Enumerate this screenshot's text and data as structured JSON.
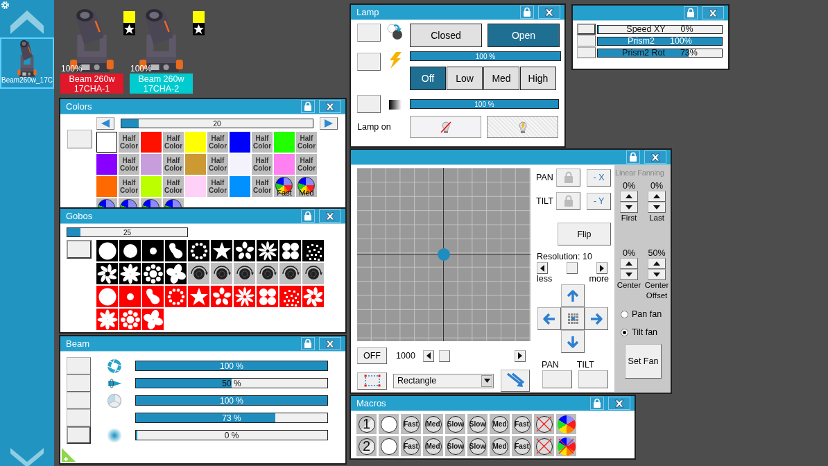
{
  "sidebar": {
    "fixtures": [
      {
        "label": "Beam260w_17C",
        "selected": true
      }
    ]
  },
  "fixtures": [
    {
      "intensity": "100%",
      "name": "Beam 260w",
      "channel": "17CHA-1",
      "color": "#e0182a"
    },
    {
      "intensity": "100%",
      "name": "Beam 260w",
      "channel": "17CHA-2",
      "color": "#00ccd0"
    }
  ],
  "colors": {
    "title": "Colors",
    "slider": {
      "value": "20",
      "level": 0.09
    },
    "swatches": [
      {
        "kind": "color",
        "color": "#ffffff"
      },
      {
        "kind": "half",
        "label": "Half Color"
      },
      {
        "kind": "color",
        "color": "#ff1100"
      },
      {
        "kind": "half",
        "label": "Half Color"
      },
      {
        "kind": "color",
        "color": "#ffff00"
      },
      {
        "kind": "half",
        "label": "Half Color"
      },
      {
        "kind": "color",
        "color": "#0000ff"
      },
      {
        "kind": "half",
        "label": "Half Color"
      },
      {
        "kind": "color",
        "color": "#22ff00"
      },
      {
        "kind": "half",
        "label": "Half Color"
      },
      {
        "kind": "color",
        "color": "#8800ff"
      },
      {
        "kind": "half",
        "label": "Half Color"
      },
      {
        "kind": "color",
        "color": "#c89ddb"
      },
      {
        "kind": "half",
        "label": "Half Color"
      },
      {
        "kind": "color",
        "color": "#cc9933"
      },
      {
        "kind": "half",
        "label": "Half Color"
      },
      {
        "kind": "color",
        "color": "#f4f2fc"
      },
      {
        "kind": "half",
        "label": "Half Color"
      },
      {
        "kind": "color",
        "color": "#ff80f0"
      },
      {
        "kind": "half",
        "label": "Half Color"
      },
      {
        "kind": "color",
        "color": "#ff6a00"
      },
      {
        "kind": "half",
        "label": "Half Color"
      },
      {
        "kind": "color",
        "color": "#bbff00"
      },
      {
        "kind": "half",
        "label": "Half Color"
      },
      {
        "kind": "color",
        "color": "#ffd0f8"
      },
      {
        "kind": "half",
        "label": "Half Color"
      },
      {
        "kind": "color",
        "color": "#0090ff"
      },
      {
        "kind": "half",
        "label": "Half Color"
      },
      {
        "kind": "wheel",
        "label": "Fast"
      },
      {
        "kind": "wheel",
        "label": "Med"
      },
      {
        "kind": "wheel"
      },
      {
        "kind": "wheel"
      },
      {
        "kind": "wheel"
      },
      {
        "kind": "wheel"
      }
    ]
  },
  "gobos": {
    "title": "Gobos",
    "slider": {
      "value": "25",
      "level": 0.11
    },
    "items": [
      {
        "kind": "disc",
        "color": "#000000"
      },
      {
        "kind": "disc-medium",
        "color": "#000000"
      },
      {
        "kind": "dot",
        "color": "#000000"
      },
      {
        "kind": "blob",
        "color": "#000000"
      },
      {
        "kind": "ring",
        "color": "#000000"
      },
      {
        "kind": "star",
        "color": "#000000"
      },
      {
        "kind": "petals",
        "color": "#000000"
      },
      {
        "kind": "burst",
        "color": "#000000"
      },
      {
        "kind": "circles",
        "color": "#000000"
      },
      {
        "kind": "dots",
        "color": "#000000"
      },
      {
        "kind": "pinwheel",
        "color": "#000000"
      },
      {
        "kind": "asterisk",
        "color": "#000000"
      },
      {
        "kind": "flower",
        "color": "#000000"
      },
      {
        "kind": "fan",
        "color": "#000000"
      },
      {
        "kind": "rotation",
        "color": "#c0c0c0"
      },
      {
        "kind": "rotation",
        "color": "#c0c0c0"
      },
      {
        "kind": "rotation",
        "color": "#c0c0c0"
      },
      {
        "kind": "rotation",
        "color": "#c0c0c0"
      },
      {
        "kind": "rotation",
        "color": "#c0c0c0"
      },
      {
        "kind": "rotation",
        "color": "#c0c0c0"
      },
      {
        "kind": "disc",
        "color": "#ff0000"
      },
      {
        "kind": "dot",
        "color": "#ff0000"
      },
      {
        "kind": "blob",
        "color": "#ff0000"
      },
      {
        "kind": "ring",
        "color": "#ff0000"
      },
      {
        "kind": "star",
        "color": "#ff0000"
      },
      {
        "kind": "petals",
        "color": "#ff0000"
      },
      {
        "kind": "burst",
        "color": "#ff0000"
      },
      {
        "kind": "circles",
        "color": "#ff0000"
      },
      {
        "kind": "dots",
        "color": "#ff0000"
      },
      {
        "kind": "pinwheel",
        "color": "#ff0000"
      },
      {
        "kind": "asterisk",
        "color": "#ff0000"
      },
      {
        "kind": "flower",
        "color": "#ff0000"
      },
      {
        "kind": "fan",
        "color": "#ff0000"
      }
    ]
  },
  "beam": {
    "title": "Beam",
    "rows": [
      {
        "kind": "iris",
        "level": 1,
        "reading": "100 %"
      },
      {
        "kind": "zoom",
        "level": 0.5,
        "reading": "50 %"
      },
      {
        "kind": "frost",
        "level": 1,
        "reading": "100 %"
      },
      {
        "kind": "blank",
        "level": 0.73,
        "reading": "73 %"
      },
      {
        "kind": "focus",
        "level": 0,
        "reading": "0 %"
      }
    ]
  },
  "lamp": {
    "title": "Lamp",
    "shutter": [
      {
        "label": "Closed",
        "selected": false
      },
      {
        "label": "Open",
        "selected": true
      }
    ],
    "dimmer": {
      "level": 1,
      "reading": "100 %"
    },
    "strobe": [
      {
        "label": "Off",
        "selected": true
      },
      {
        "label": "Low",
        "selected": false
      },
      {
        "label": "Med",
        "selected": false
      },
      {
        "label": "High",
        "selected": false
      }
    ],
    "fade": {
      "level": 1,
      "reading": "100 %"
    },
    "lamp_label": "Lamp on",
    "lamp_buttons": [
      {
        "kind": "off",
        "selected": false
      },
      {
        "kind": "on",
        "selected": true
      }
    ]
  },
  "effects": {
    "rows": [
      {
        "label": "Speed XY",
        "reading": "0%",
        "level": 0
      },
      {
        "label": "Prism2",
        "reading": "100%",
        "level": 1
      },
      {
        "label": "Prism2 Rot",
        "reading": "73%",
        "level": 0.73
      }
    ]
  },
  "position": {
    "pan_label": "PAN",
    "tilt_label": "TILT",
    "invert_x": "- X",
    "invert_y": "- Y",
    "flip": "Flip",
    "resolution": {
      "label": "Resolution: 10",
      "level": 0.5,
      "less": "less",
      "more": "more"
    },
    "off": "OFF",
    "speed": {
      "value": "1000",
      "level": 0.04
    },
    "shape": "Rectangle",
    "pan_button": "PAN",
    "tilt_button": "TILT",
    "fanning": {
      "title": "Linear Fanning",
      "spinners": [
        {
          "value": "0%",
          "label": "First"
        },
        {
          "value": "0%",
          "label": "Last"
        },
        {
          "value": "0%",
          "label": "Center"
        },
        {
          "value": "50%",
          "label": "Center Offset"
        }
      ],
      "radios": [
        {
          "label": "Pan fan",
          "selected": false
        },
        {
          "label": "Tilt fan",
          "selected": true
        }
      ],
      "set_fan": "Set Fan"
    }
  },
  "macros": {
    "title": "Macros",
    "rows": [
      {
        "items": [
          {
            "kind": "number",
            "label": "1"
          },
          {
            "kind": "blank"
          },
          {
            "kind": "speed",
            "label": "Fast"
          },
          {
            "kind": "speed",
            "label": "Med"
          },
          {
            "kind": "speed",
            "label": "Slow"
          },
          {
            "kind": "speed",
            "label": "Slow"
          },
          {
            "kind": "speed",
            "label": "Med"
          },
          {
            "kind": "speed",
            "label": "Fast"
          },
          {
            "kind": "stop"
          },
          {
            "kind": "wheel"
          }
        ]
      },
      {
        "items": [
          {
            "kind": "number",
            "label": "2"
          },
          {
            "kind": "blank"
          },
          {
            "kind": "speed",
            "label": "Fast"
          },
          {
            "kind": "speed",
            "label": "Med"
          },
          {
            "kind": "speed",
            "label": "Slow"
          },
          {
            "kind": "speed",
            "label": "Slow"
          },
          {
            "kind": "speed",
            "label": "Med"
          },
          {
            "kind": "speed",
            "label": "Fast"
          },
          {
            "kind": "stop"
          },
          {
            "kind": "wheel-off"
          }
        ]
      }
    ]
  }
}
